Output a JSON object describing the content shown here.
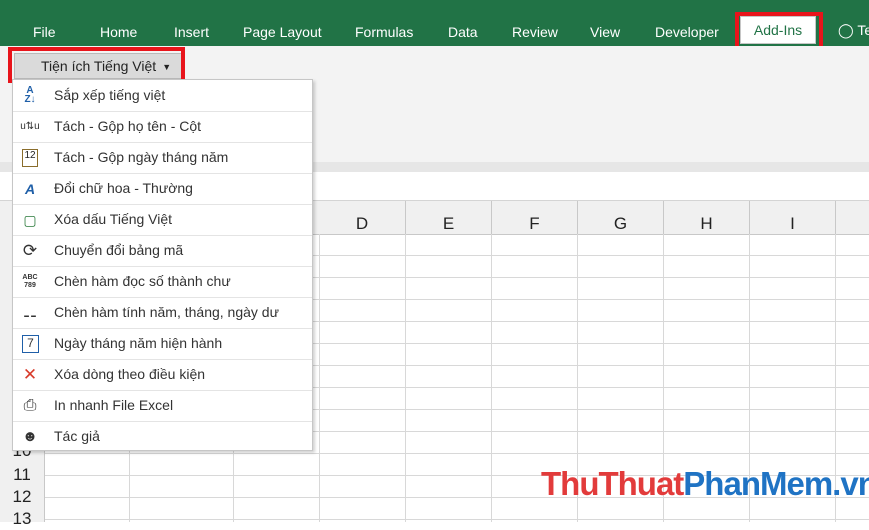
{
  "ribbon_tabs": [
    "File",
    "Home",
    "Insert",
    "Page Layout",
    "Formulas",
    "Data",
    "Review",
    "View",
    "Developer"
  ],
  "active_tab": "Add-Ins",
  "tell_me_partial": "Te",
  "addin_button": {
    "label": "Tiện ích Tiếng Việt"
  },
  "menu": {
    "items": [
      {
        "label": "Sắp xếp tiếng việt",
        "icon": "sort-az-icon"
      },
      {
        "label": "Tách - Gộp họ tên - Cột",
        "icon": "split-merge-icon"
      },
      {
        "label": "Tách - Gộp ngày tháng năm",
        "icon": "calendar-split-icon"
      },
      {
        "label": "Đổi chữ hoa - Thường",
        "icon": "change-case-icon"
      },
      {
        "label": "Xóa dấu Tiếng Việt",
        "icon": "remove-accents-icon"
      },
      {
        "label": "Chuyển đổi bảng mã",
        "icon": "convert-encoding-icon"
      },
      {
        "label": "Chèn hàm đọc số thành chư",
        "icon": "number-to-text-icon"
      },
      {
        "label": "Chèn hàm tính năm, tháng, ngày dư",
        "icon": "date-function-icon"
      },
      {
        "label": "Ngày tháng năm hiện hành",
        "icon": "current-date-icon"
      },
      {
        "label": "Xóa dòng theo điều kiện",
        "icon": "delete-row-icon"
      },
      {
        "label": "In nhanh File Excel",
        "icon": "printer-icon"
      },
      {
        "label": "Tác giả",
        "icon": "author-icon"
      }
    ]
  },
  "columns": [
    "D",
    "E",
    "F",
    "G",
    "H",
    "I"
  ],
  "rows": [
    "10",
    "11",
    "12",
    "13"
  ],
  "watermark": {
    "part1": "ThuThuat",
    "part2": "PhanMem",
    "part3": ".vn"
  },
  "colors": {
    "excel_green": "#217346",
    "highlight_red": "#e8141b"
  }
}
